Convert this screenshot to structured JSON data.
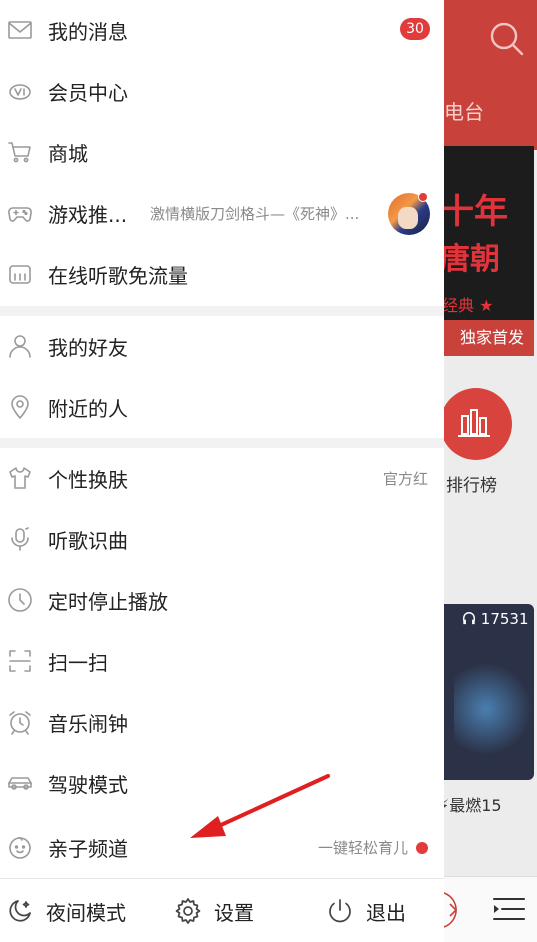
{
  "background": {
    "tab_partial": "电台",
    "banner_line1": "十年",
    "banner_line2": "唐朝",
    "banner_line3": "经典 ★",
    "banner_tag": "独家首发",
    "rank_label": "排行榜",
    "card_count": "17531",
    "card_title": "⚡最燃15"
  },
  "drawer": {
    "messages": {
      "label": "我的消息",
      "badge": "30"
    },
    "vip": {
      "label": "会员中心"
    },
    "store": {
      "label": "商城"
    },
    "games": {
      "label": "游戏推...",
      "desc": "激情横版刀剑格斗—《死神》..."
    },
    "free_data": {
      "label": "在线听歌免流量"
    },
    "friends": {
      "label": "我的好友"
    },
    "nearby": {
      "label": "附近的人"
    },
    "skin": {
      "label": "个性换肤",
      "value": "官方红"
    },
    "recognize": {
      "label": "听歌识曲"
    },
    "timer": {
      "label": "定时停止播放"
    },
    "scan": {
      "label": "扫一扫"
    },
    "alarm": {
      "label": "音乐闹钟"
    },
    "drive": {
      "label": "驾驶模式"
    },
    "kids": {
      "label": "亲子频道",
      "value": "一键轻松育儿"
    }
  },
  "bottom_bar": {
    "night": "夜间模式",
    "settings": "设置",
    "exit": "退出"
  },
  "colors": {
    "accent": "#c9413b",
    "badge": "#e23b3b",
    "arrow": "#e02020"
  }
}
